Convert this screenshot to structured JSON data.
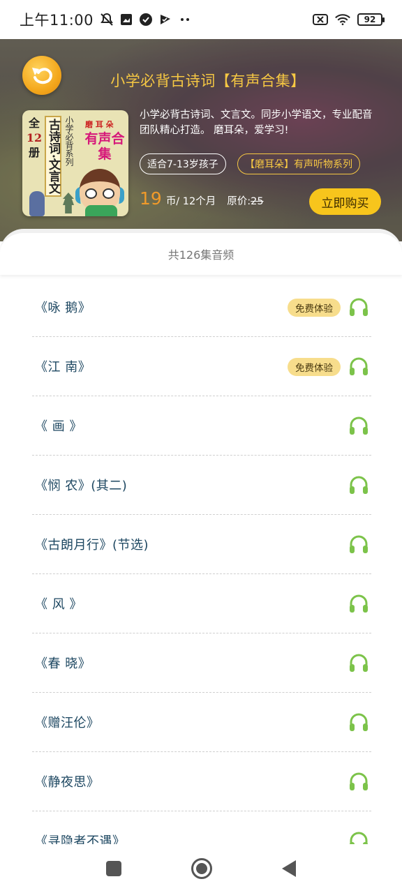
{
  "status_bar": {
    "time": "上午11:00",
    "battery": "92"
  },
  "header": {
    "title": "小学必背古诗词【有声合集】",
    "description": "小学必背古诗词、文言文。同步小学语文，专业配音团队精心打造。 磨耳朵，爱学习!",
    "tags": [
      "适合7-13岁孩子",
      "【磨耳朵】有声听物系列"
    ],
    "price": "19",
    "price_unit": "币/ 12个月",
    "original_label": "原价:",
    "original_price": "25",
    "buy_label": "立即购买"
  },
  "cover": {
    "left_col_top": "全",
    "left_col_num": "12",
    "left_col_bottom": "册",
    "main_vertical": "古诗词·文言文",
    "sub_vertical": "小学必背系列",
    "tag": "磨 耳 朵",
    "big_text": "有声合集"
  },
  "count_text": "共126集音频",
  "episodes": [
    {
      "title": "《咏 鹅》",
      "badge": "免费体验"
    },
    {
      "title": "《江 南》",
      "badge": "免费体验"
    },
    {
      "title": "《 画 》",
      "badge": ""
    },
    {
      "title": "《悯 农》(其二)",
      "badge": ""
    },
    {
      "title": "《古朗月行》(节选)",
      "badge": ""
    },
    {
      "title": "《 风 》",
      "badge": ""
    },
    {
      "title": "《春 晓》",
      "badge": ""
    },
    {
      "title": "《赠汪伦》",
      "badge": ""
    },
    {
      "title": "《静夜思》",
      "badge": ""
    },
    {
      "title": "《寻隐者不遇》",
      "badge": ""
    }
  ],
  "colors": {
    "accent_yellow": "#f7c51c",
    "title_gold": "#f6c843",
    "price_orange": "#f09a2a",
    "episode_text": "#1d4761",
    "headphone_green": "#7cc34a"
  },
  "icons": {
    "back": "back-arrow-icon",
    "episode": "headphones-icon"
  }
}
